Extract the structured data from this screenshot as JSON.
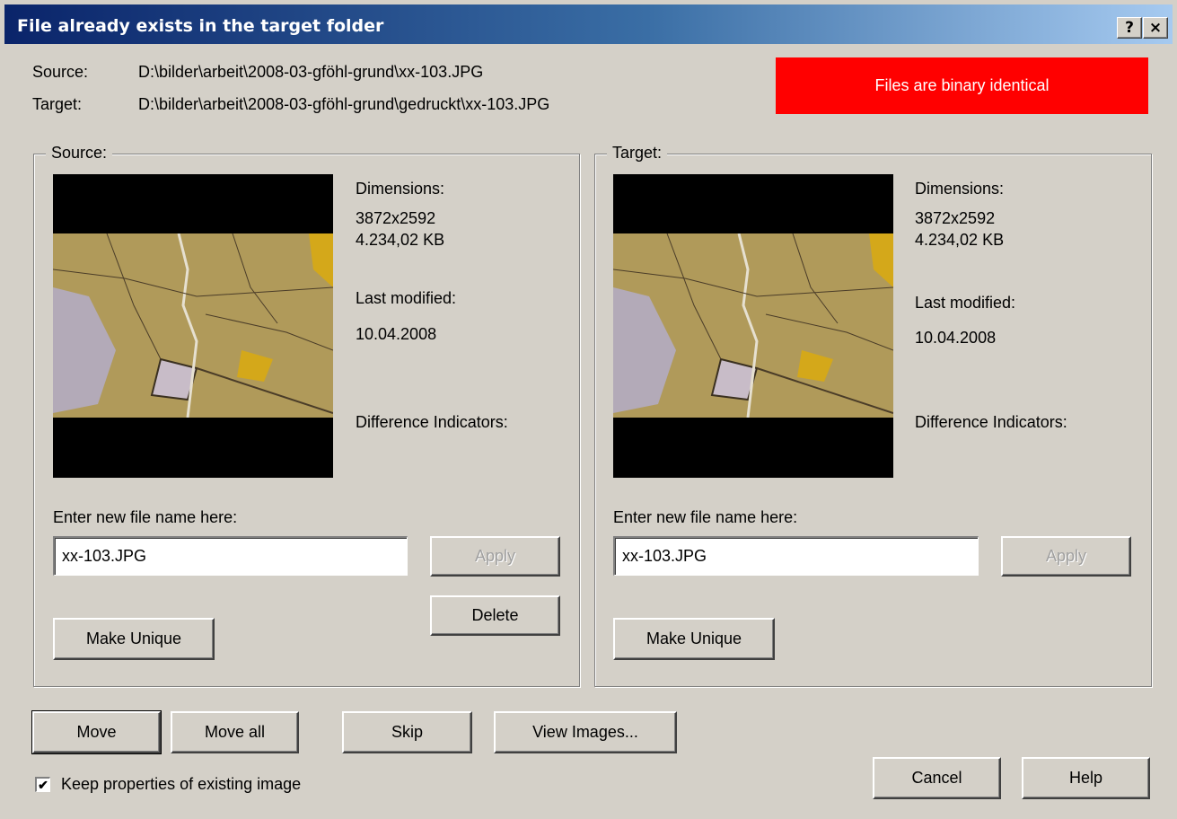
{
  "window": {
    "title": "File already exists in the target folder",
    "help_glyph": "?",
    "close_glyph": "×"
  },
  "paths": {
    "source_label": "Source:",
    "source_value": "D:\\bilder\\arbeit\\2008-03-gföhl-grund\\xx-103.JPG",
    "target_label": "Target:",
    "target_value": "D:\\bilder\\arbeit\\2008-03-gföhl-grund\\gedruckt\\xx-103.JPG"
  },
  "status": {
    "text": "Files are binary identical",
    "color": "#ff0000"
  },
  "source_panel": {
    "legend": "Source:",
    "dimensions_label": "Dimensions:",
    "dimensions": "3872x2592",
    "size": "4.234,02 KB",
    "modified_label": "Last modified:",
    "modified": "10.04.2008",
    "diff_label": "Difference Indicators:",
    "filename_label": "Enter new file name here:",
    "filename": "xx-103.JPG",
    "apply_label": "Apply",
    "delete_label": "Delete",
    "unique_label": "Make Unique"
  },
  "target_panel": {
    "legend": "Target:",
    "dimensions_label": "Dimensions:",
    "dimensions": "3872x2592",
    "size": "4.234,02 KB",
    "modified_label": "Last modified:",
    "modified": "10.04.2008",
    "diff_label": "Difference Indicators:",
    "filename_label": "Enter new file name here:",
    "filename": "xx-103.JPG",
    "apply_label": "Apply",
    "unique_label": "Make Unique"
  },
  "actions": {
    "move": "Move",
    "move_all": "Move all",
    "skip": "Skip",
    "view_images": "View Images...",
    "cancel": "Cancel",
    "help": "Help"
  },
  "options": {
    "keep_properties_label": "Keep properties of existing image",
    "keep_properties_checked": true
  }
}
